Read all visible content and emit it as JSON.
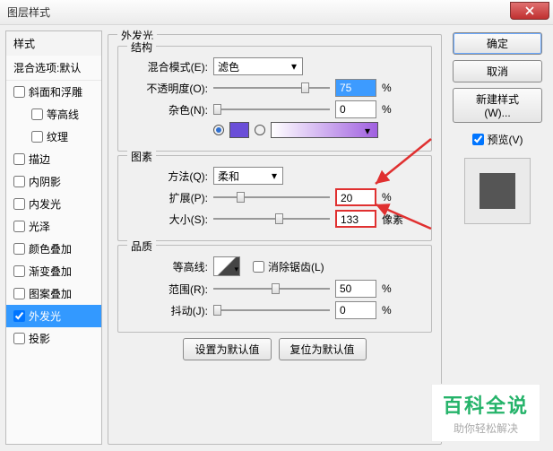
{
  "window": {
    "title": "图层样式",
    "close": "×"
  },
  "sidebar": {
    "header": "样式",
    "sub": "混合选项:默认",
    "items": [
      {
        "label": "斜面和浮雕",
        "checked": false
      },
      {
        "label": "等高线",
        "checked": false,
        "indent": true
      },
      {
        "label": "纹理",
        "checked": false,
        "indent": true
      },
      {
        "label": "描边",
        "checked": false
      },
      {
        "label": "内阴影",
        "checked": false
      },
      {
        "label": "内发光",
        "checked": false
      },
      {
        "label": "光泽",
        "checked": false
      },
      {
        "label": "颜色叠加",
        "checked": false
      },
      {
        "label": "渐变叠加",
        "checked": false
      },
      {
        "label": "图案叠加",
        "checked": false
      },
      {
        "label": "外发光",
        "checked": true,
        "selected": true
      },
      {
        "label": "投影",
        "checked": false
      }
    ]
  },
  "panel": {
    "title": "外发光",
    "structure": {
      "title": "结构",
      "blend_label": "混合模式(E):",
      "blend_value": "滤色",
      "opacity_label": "不透明度(O):",
      "opacity_value": "75",
      "opacity_unit": "%",
      "noise_label": "杂色(N):",
      "noise_value": "0",
      "noise_unit": "%",
      "color_hex": "#6a4ed8"
    },
    "elements": {
      "title": "图素",
      "technique_label": "方法(Q):",
      "technique_value": "柔和",
      "spread_label": "扩展(P):",
      "spread_value": "20",
      "spread_unit": "%",
      "size_label": "大小(S):",
      "size_value": "133",
      "size_unit": "像素"
    },
    "quality": {
      "title": "品质",
      "contour_label": "等高线:",
      "antialias_label": "消除锯齿(L)",
      "range_label": "范围(R):",
      "range_value": "50",
      "range_unit": "%",
      "jitter_label": "抖动(J):",
      "jitter_value": "0",
      "jitter_unit": "%"
    },
    "buttons": {
      "default": "设置为默认值",
      "reset": "复位为默认值"
    }
  },
  "right": {
    "ok": "确定",
    "cancel": "取消",
    "newstyle": "新建样式(W)...",
    "preview_label": "预览(V)"
  },
  "watermark": {
    "big": "百科全说",
    "small": "助你轻松解决"
  }
}
